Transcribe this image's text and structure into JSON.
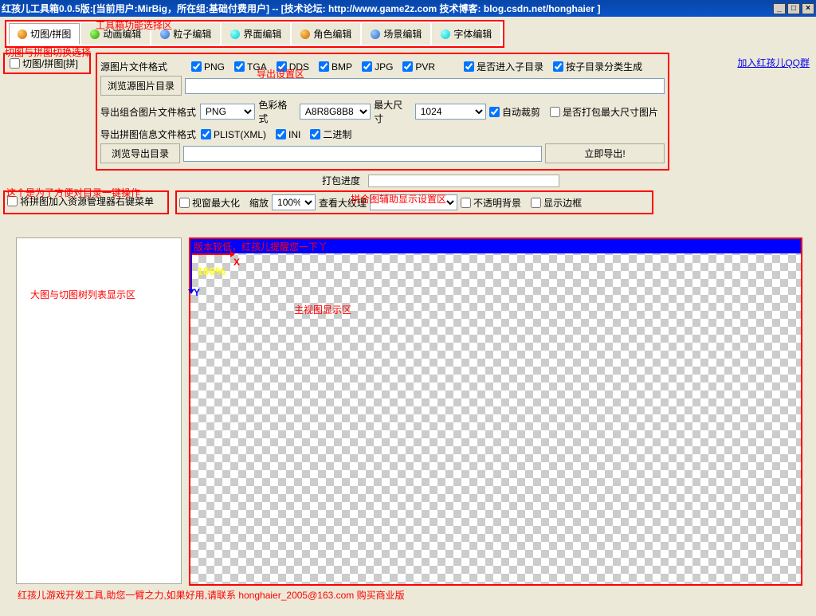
{
  "window": {
    "title": "红孩儿工具箱0.0.5版:[当前用户:MirBig，所在组:基础付费用户]  --  [技术论坛: http://www.game2z.com 技术博客: blog.csdn.net/honghaier ]",
    "minimize": "_",
    "maximize": "□",
    "close": "×"
  },
  "tabs": [
    {
      "label": "切图/拼图",
      "icon": "orange",
      "active": true
    },
    {
      "label": "动画编辑",
      "icon": "green",
      "active": false
    },
    {
      "label": "粒子编辑",
      "icon": "blue",
      "active": false
    },
    {
      "label": "界面编辑",
      "icon": "cyan",
      "active": false
    },
    {
      "label": "角色编辑",
      "icon": "orange",
      "active": false
    },
    {
      "label": "场景编辑",
      "icon": "blue",
      "active": false
    },
    {
      "label": "字体编辑",
      "icon": "cyan",
      "active": false
    }
  ],
  "annotations": {
    "tabs_area": "工具箱功能选择区",
    "switch_area": "切图与拼图切换选择",
    "export_area": "导出设置区",
    "context_menu": "这个是为了方便对目录一键操作",
    "display_settings": "拼合图辅助显示设置区",
    "tree_area": "大图与切图树列表显示区",
    "main_view": "主视图显示区"
  },
  "switch": {
    "label": "切图/拼图[拼]"
  },
  "export": {
    "source_format_label": "源图片文件格式",
    "png": "PNG",
    "tga": "TGA",
    "dds": "DDS",
    "bmp": "BMP",
    "jpg": "JPG",
    "pvr": "PVR",
    "recurse_sub": "是否进入子目录",
    "by_dir_gen": "按子目录分类生成",
    "browse_src": "浏览源图片目录",
    "src_path": "",
    "combo_format_label": "导出组合图片文件格式",
    "combo_format_value": "PNG",
    "color_format_label": "色彩格式",
    "color_format_value": "A8R8G8B8",
    "max_size_label": "最大尺寸",
    "max_size_value": "1024",
    "auto_crop": "自动裁剪",
    "pack_max": "是否打包最大尺寸图片",
    "info_format_label": "导出拼图信息文件格式",
    "plist": "PLIST(XML)",
    "ini": "INI",
    "binary": "二进制",
    "browse_out": "浏览导出目录",
    "out_path": "",
    "export_now": "立即导出!",
    "pack_progress": "打包进度"
  },
  "context_menu": {
    "label": "将拼图加入资源管理器右键菜单"
  },
  "display": {
    "maximize_view": "视窗最大化",
    "zoom_label": "缩放",
    "zoom_value": "100%",
    "view_big_tex": "查看大纹理",
    "big_tex_value": "",
    "opaque_bg": "不透明背景",
    "show_border": "显示边框"
  },
  "link": {
    "qq_group": "加入红孩儿QQ群"
  },
  "view": {
    "header_text": "版本较低，红孩儿提醒您一下丫",
    "zoom_display": "100%",
    "x": "X",
    "y": "Y"
  },
  "footer": "红孩儿游戏开发工具,助您一臂之力,如果好用,请联系 honghaier_2005@163.com 购买商业版"
}
